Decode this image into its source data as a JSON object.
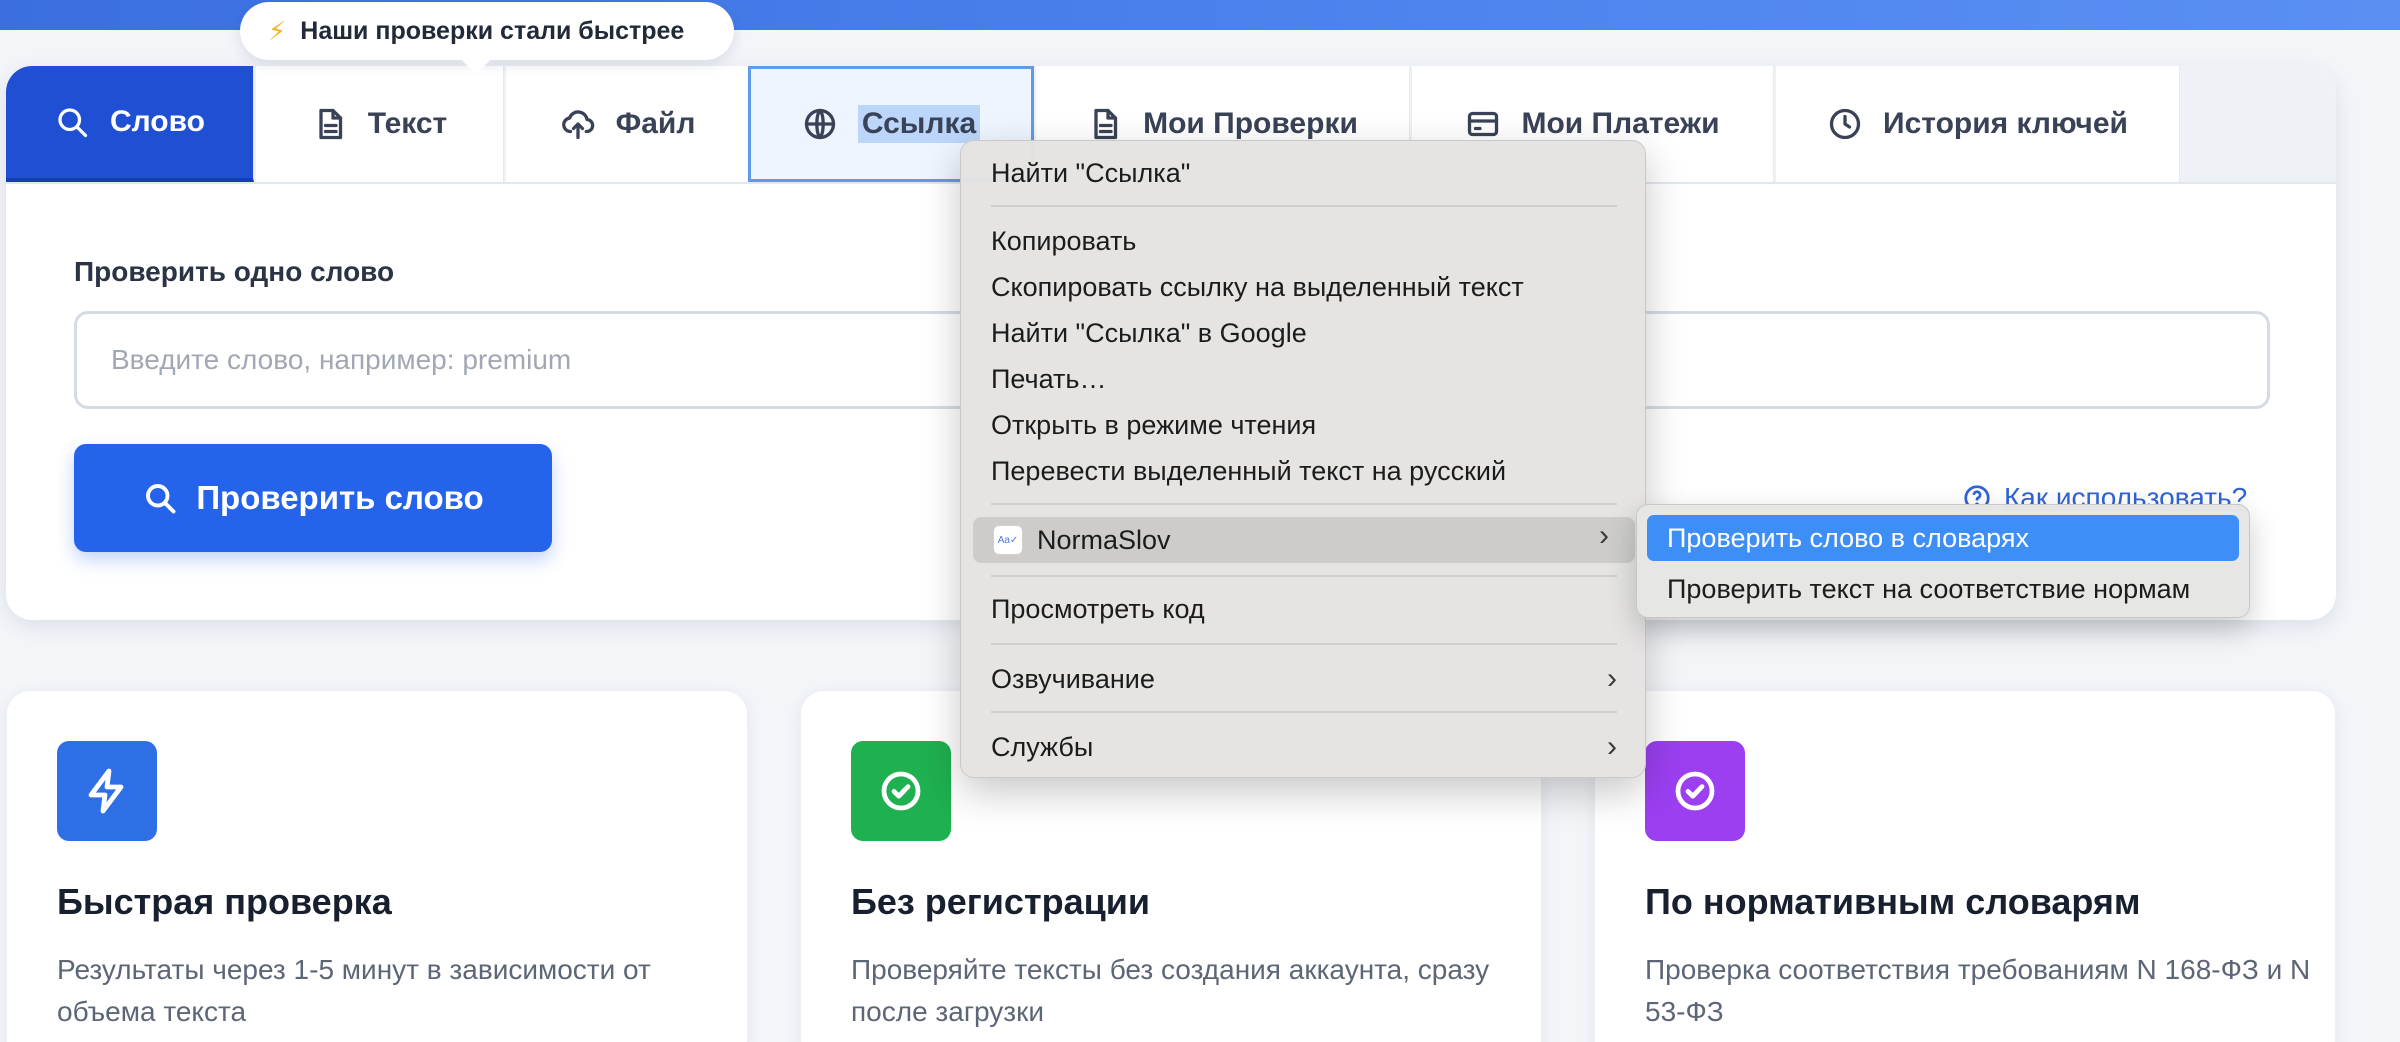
{
  "announcement": {
    "text": "Наши проверки стали быстрее"
  },
  "tabs": [
    {
      "label": "Слово",
      "icon": "search-icon"
    },
    {
      "label": "Текст",
      "icon": "document-icon"
    },
    {
      "label": "Файл",
      "icon": "cloud-upload-icon"
    },
    {
      "label": "Ссылка",
      "icon": "globe-icon"
    },
    {
      "label": "Мои Проверки",
      "icon": "document-icon"
    },
    {
      "label": "Мои Платежи",
      "icon": "card-icon"
    },
    {
      "label": "История ключей",
      "icon": "clock-icon"
    }
  ],
  "word_check": {
    "label": "Проверить одно слово",
    "placeholder": "Введите слово, например: premium",
    "button": "Проверить слово",
    "help_link": "Как использовать?"
  },
  "features": [
    {
      "title": "Быстрая проверка",
      "text": "Результаты через 1-5 минут в зависимости от объема текста",
      "color": "#2f6fe6",
      "icon": "lightning-icon"
    },
    {
      "title": "Без регистрации",
      "text": "Проверяйте тексты без создания аккаунта, сразу после загрузки",
      "color": "#1fb04f",
      "icon": "check-circle-icon"
    },
    {
      "title": "По нормативным словарям",
      "text": "Проверка соответствия требованиям N 168-ФЗ и N 53-ФЗ",
      "color": "#9b3ff0",
      "icon": "check-circle-icon"
    }
  ],
  "context_menu": {
    "find": "Найти \"Ссылка\"",
    "copy": "Копировать",
    "copy_link": "Скопировать ссылку на выделенный текст",
    "google": "Найти \"Ссылка\" в Google",
    "print": "Печать…",
    "reader": "Открыть в режиме чтения",
    "translate": "Перевести выделенный текст на русский",
    "extension": "NormaSlov",
    "inspect": "Просмотреть код",
    "speech": "Озвучивание",
    "services": "Службы",
    "chevron": "›",
    "extension_logo": "Aa✓"
  },
  "submenu": {
    "check_word": "Проверить слово в словарях",
    "check_text": "Проверить текст на соответствие нормам"
  }
}
